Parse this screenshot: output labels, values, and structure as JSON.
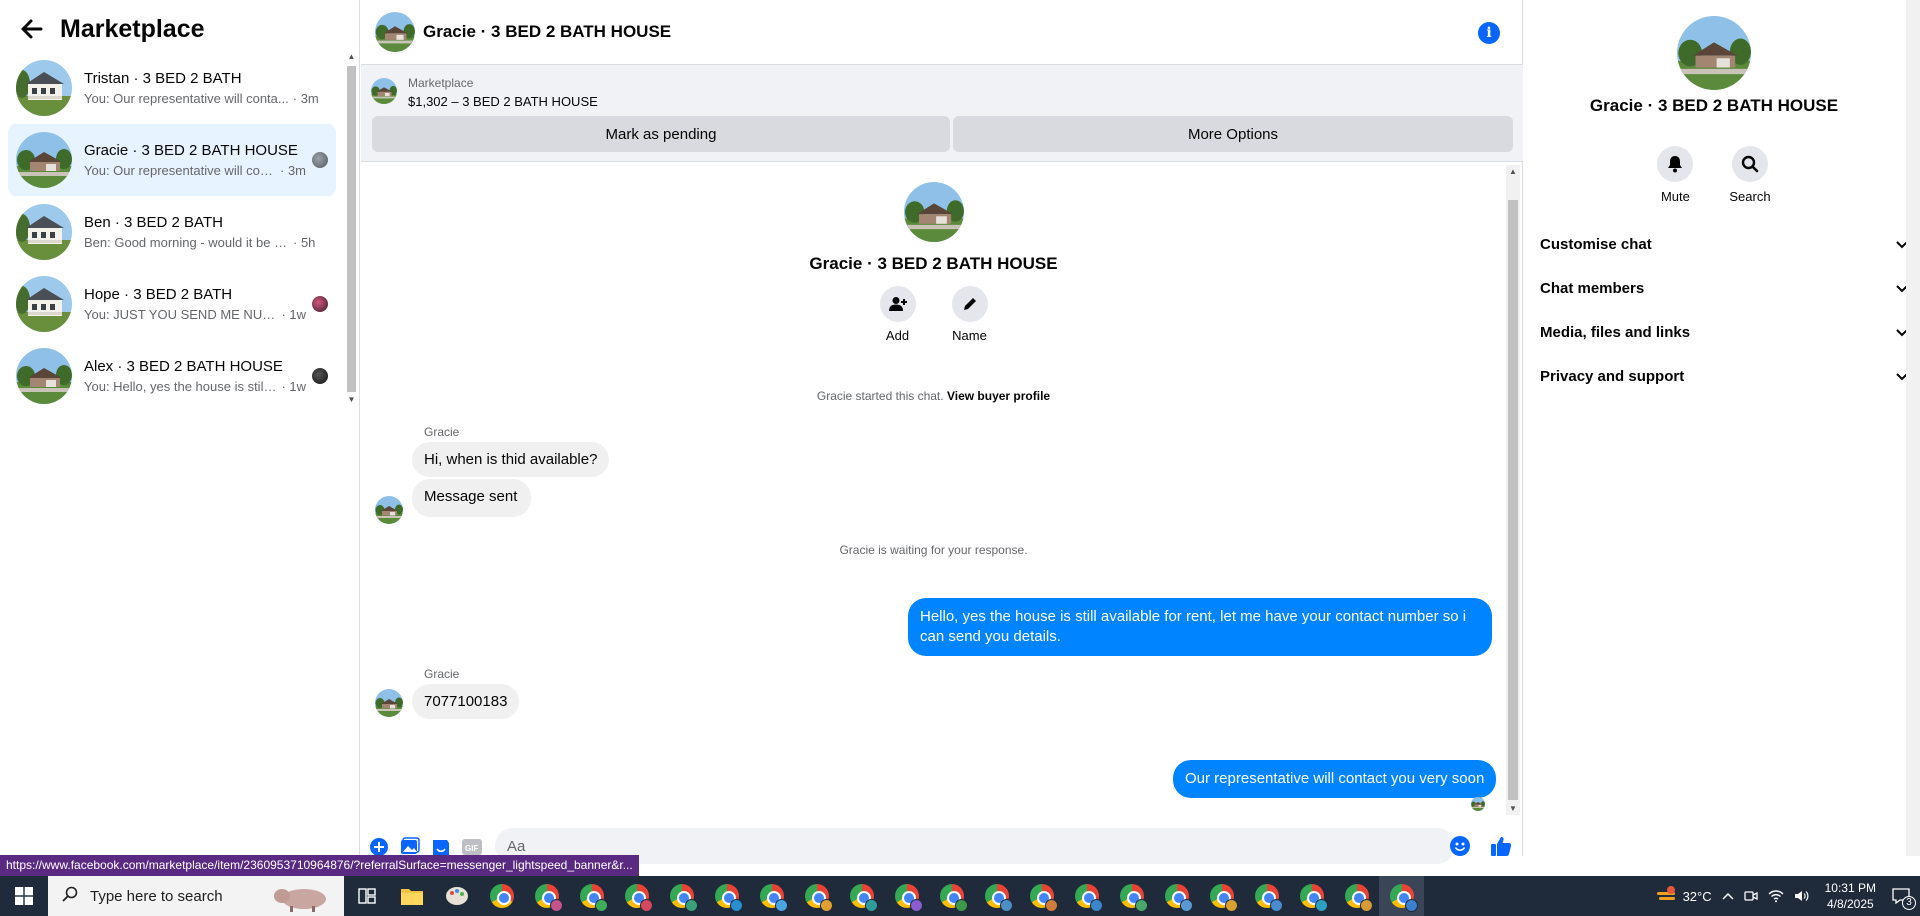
{
  "left": {
    "title": "Marketplace",
    "conversations": [
      {
        "name": "Tristan · 3 BED 2 BATH",
        "snippet": "You: Our representative will conta...",
        "time": "· 3m"
      },
      {
        "name": "Gracie · 3 BED 2 BATH HOUSE",
        "snippet": "You: Our representative will con...",
        "time": "· 3m"
      },
      {
        "name": "Ben · 3 BED 2 BATH",
        "snippet": "Ben: Good morning - would it be p...",
        "time": "· 5h"
      },
      {
        "name": "Hope · 3 BED 2 BATH",
        "snippet": "You: JUST YOU SEND ME NUM...",
        "time": "· 1w"
      },
      {
        "name": "Alex · 3 BED 2 BATH HOUSE",
        "snippet": "You: Hello, yes the house is still ...",
        "time": "· 1w"
      }
    ]
  },
  "chat": {
    "title": "Gracie · 3 BED 2 BATH HOUSE",
    "listing": {
      "source": "Marketplace",
      "price_title": "$1,302 – 3 BED 2 BATH HOUSE",
      "pending_label": "Mark as pending",
      "more_label": "More Options"
    },
    "profile": {
      "name": "Gracie · 3 BED 2 BATH HOUSE",
      "add_label": "Add",
      "name_label": "Name"
    },
    "started_text": "Gracie started this chat.",
    "view_profile": "View buyer profile",
    "messages": {
      "sender1": "Gracie",
      "in1": "Hi, when is thid available?",
      "in2": "Message sent",
      "waiting": "Gracie is waiting for your response.",
      "out1": "Hello, yes the house is still available for rent, let me have your contact number so i can send you details.",
      "sender2": "Gracie",
      "in3": "7077100183",
      "out2": "Our representative will contact you very soon"
    },
    "composer": {
      "placeholder": "Aa"
    }
  },
  "right": {
    "name": "Gracie · 3 BED 2 BATH HOUSE",
    "mute_label": "Mute",
    "search_label": "Search",
    "sections": [
      "Customise chat",
      "Chat members",
      "Media, files and links",
      "Privacy and support"
    ]
  },
  "status_url": "https://www.facebook.com/marketplace/item/2360953710964876/?referralSurface=messenger_lightspeed_banner&r...",
  "taskbar": {
    "search_placeholder": "Type here to search",
    "weather": "32°C",
    "time": "10:31 PM",
    "date": "4/8/2025",
    "notification_count": "3"
  },
  "colors": {
    "accent": "#0866ff",
    "outgoing_bubble": "#0084ff",
    "active_conversation": "#e7f3ff"
  }
}
